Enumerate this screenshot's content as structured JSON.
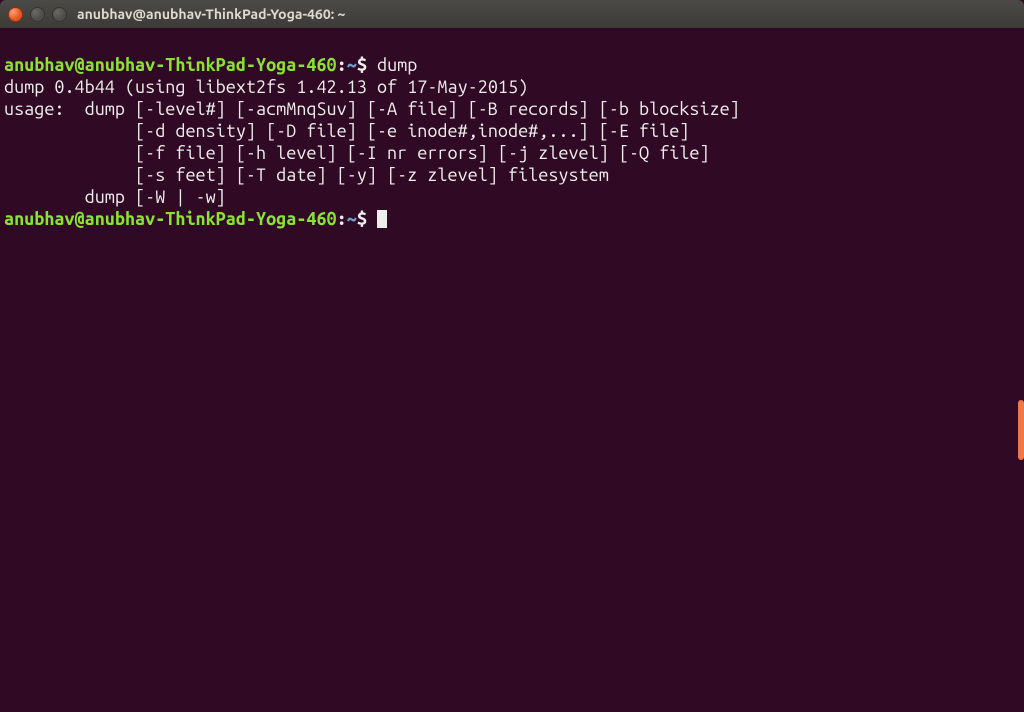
{
  "window": {
    "title": "anubhav@anubhav-ThinkPad-Yoga-460: ~"
  },
  "prompt1": {
    "userhost": "anubhav@anubhav-ThinkPad-Yoga-460",
    "colon": ":",
    "path": "~",
    "dollar": "$",
    "command": "dump"
  },
  "output": {
    "line1": "dump 0.4b44 (using libext2fs 1.42.13 of 17-May-2015)",
    "line2": "usage:  dump [-level#] [-acmMnqSuv] [-A file] [-B records] [-b blocksize]",
    "line3": "             [-d density] [-D file] [-e inode#,inode#,...] [-E file]",
    "line4": "             [-f file] [-h level] [-I nr errors] [-j zlevel] [-Q file]",
    "line5": "             [-s feet] [-T date] [-y] [-z zlevel] filesystem",
    "line6": "        dump [-W | -w]"
  },
  "prompt2": {
    "userhost": "anubhav@anubhav-ThinkPad-Yoga-460",
    "colon": ":",
    "path": "~",
    "dollar": "$"
  }
}
